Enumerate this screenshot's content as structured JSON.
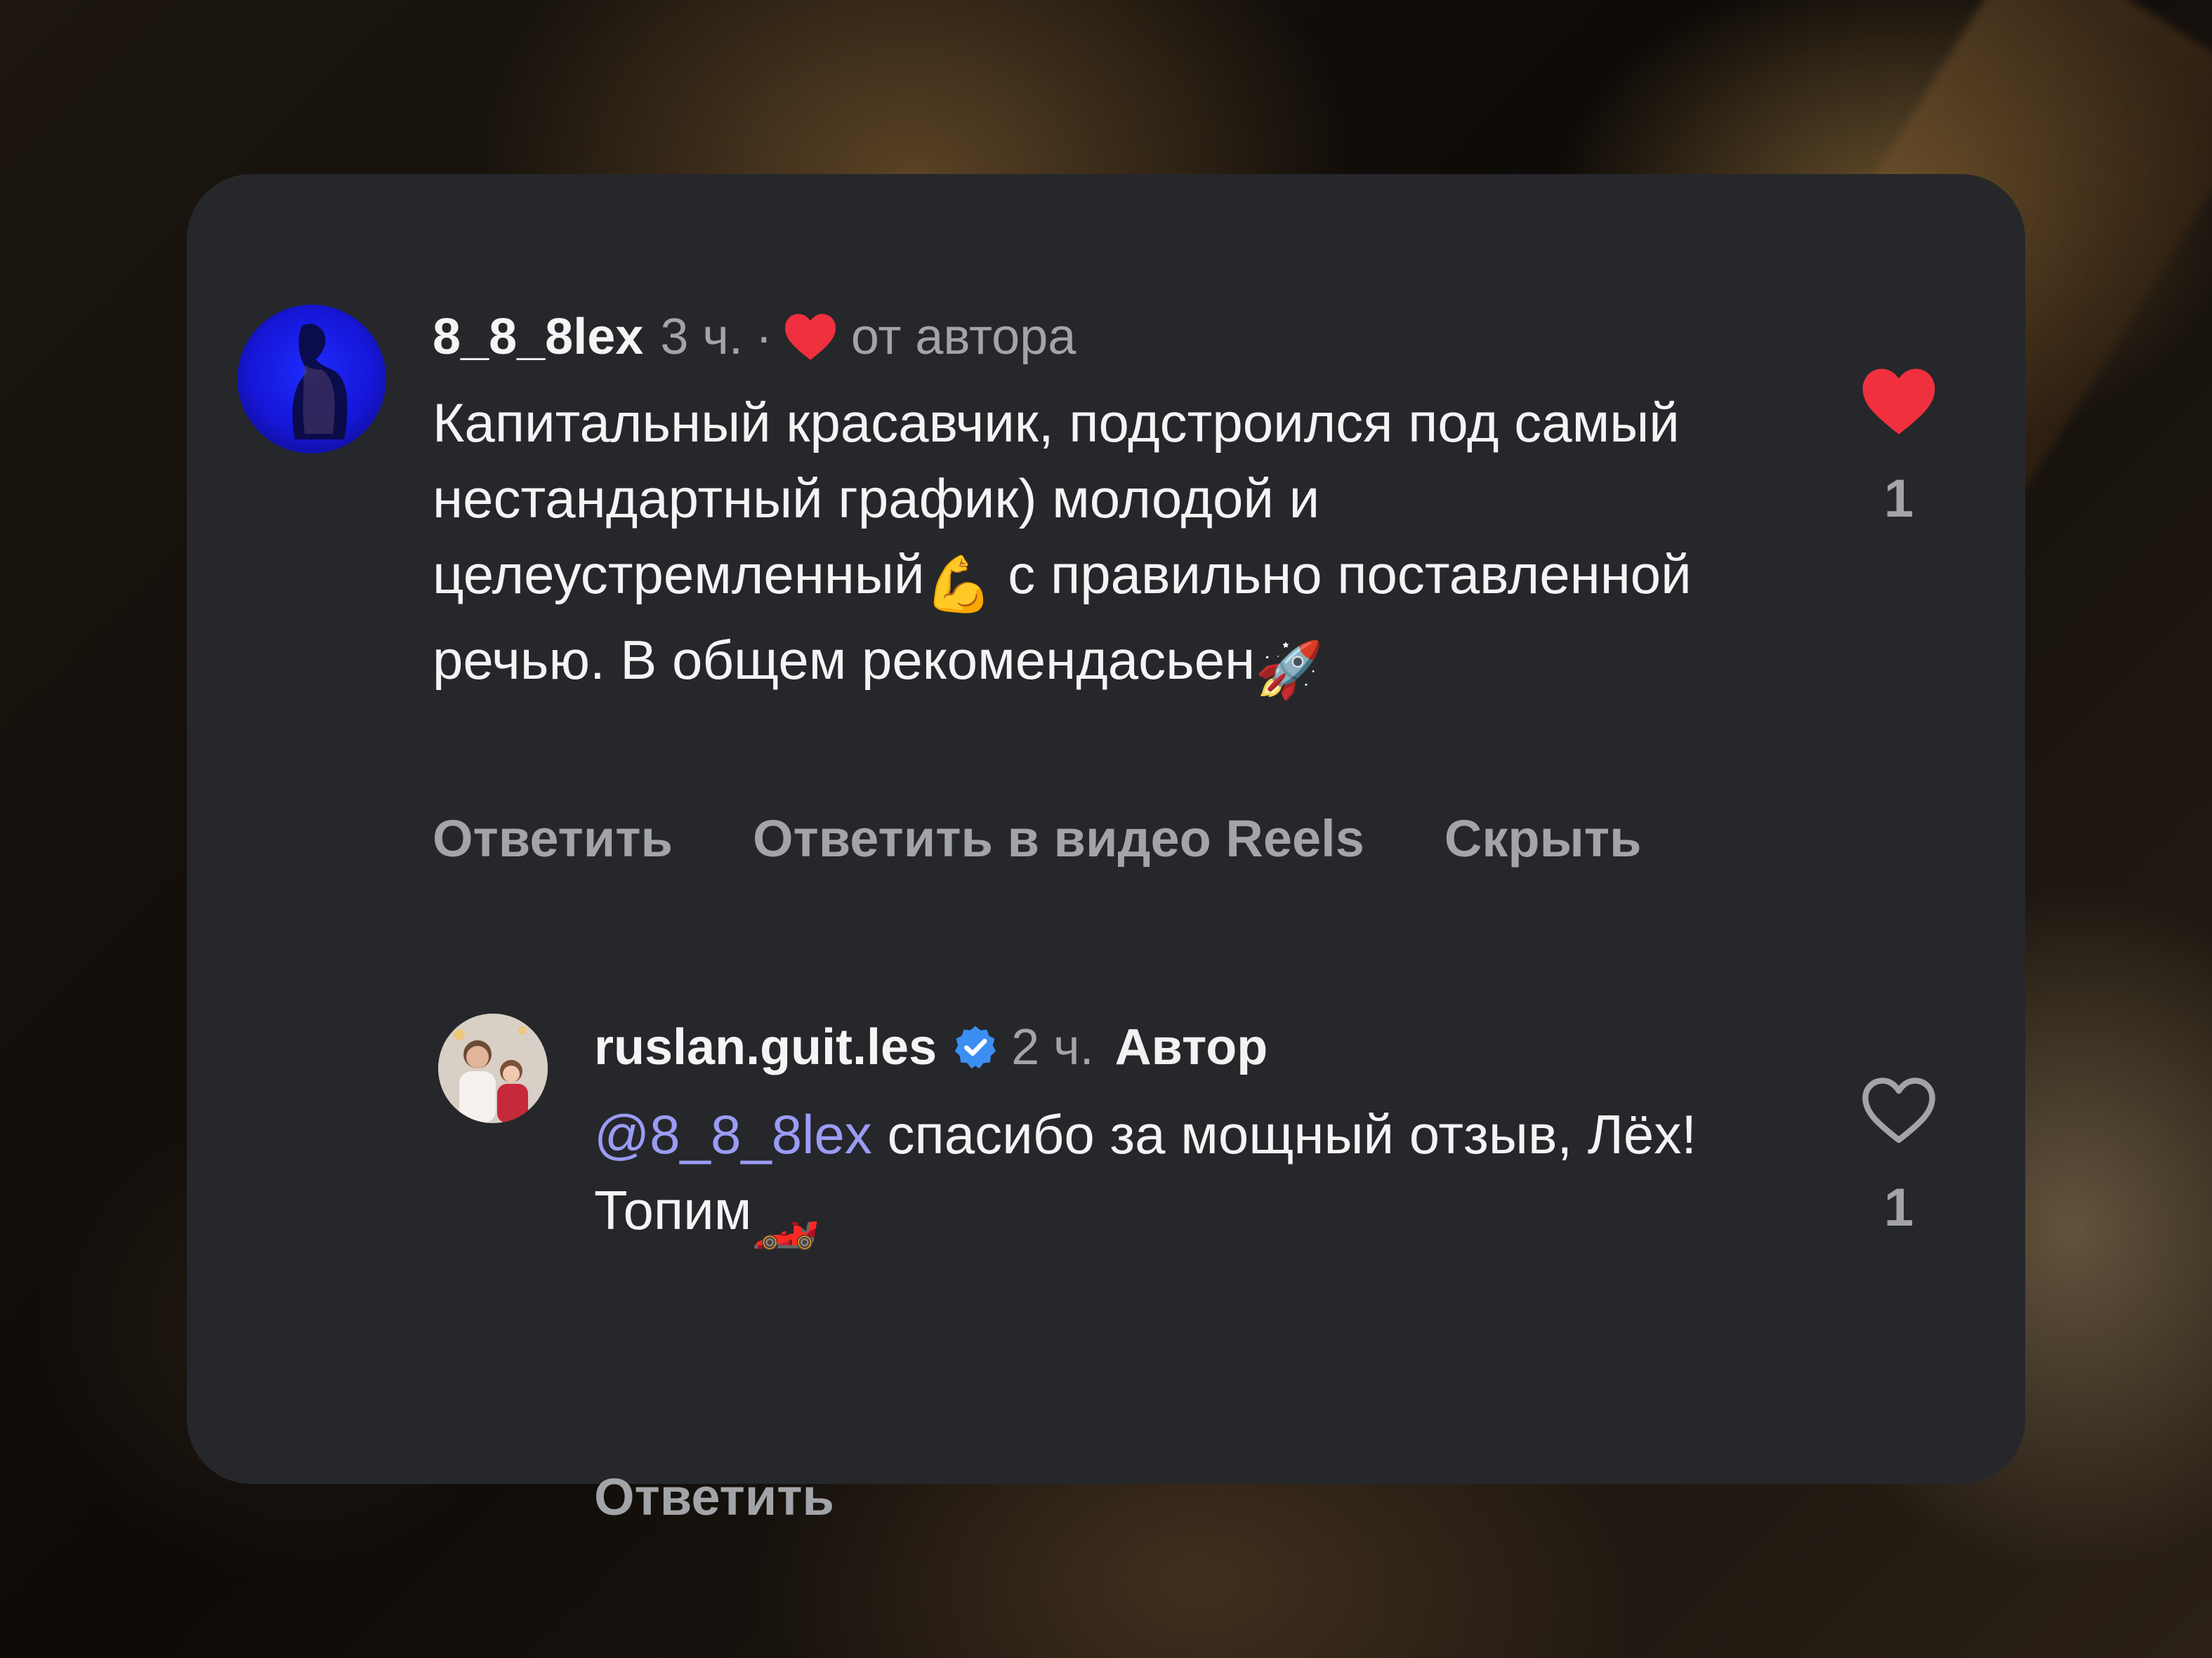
{
  "comments": [
    {
      "username": "8_8_8lex",
      "time": "3 ч.",
      "separator": "·",
      "author_like_label": "от автора",
      "text": "Капитальный красавчик, подстроился под самый нестандартный график) молодой и целеустремленный",
      "text_emoji_1": "💪",
      "text_cont": " с правильно поставленной речью. В общем рекомендасьен",
      "text_emoji_2": "🚀",
      "actions": [
        "Ответить",
        "Ответить в видео Reels",
        "Скрыть"
      ],
      "likes": "1",
      "liked": true
    },
    {
      "username": "ruslan.guit.les",
      "verified": true,
      "time": "2 ч.",
      "author_badge": "Автор",
      "mention": "@8_8_8lex",
      "text": " спасибо за мощный отзыв, Лёх! Топим",
      "text_emoji": "🏎️",
      "actions": [
        "Ответить"
      ],
      "likes": "1",
      "liked": false
    }
  ],
  "colors": {
    "card": "#25272b",
    "heart_red": "#f0303e",
    "mention": "#9a9cf5",
    "verified_blue": "#3b8ff3",
    "muted_text": "#a3a4a8"
  },
  "icons": {
    "author_like": "heart-icon",
    "verified": "verified-badge-icon",
    "like_filled": "heart-filled-icon",
    "like_outline": "heart-outline-icon"
  }
}
